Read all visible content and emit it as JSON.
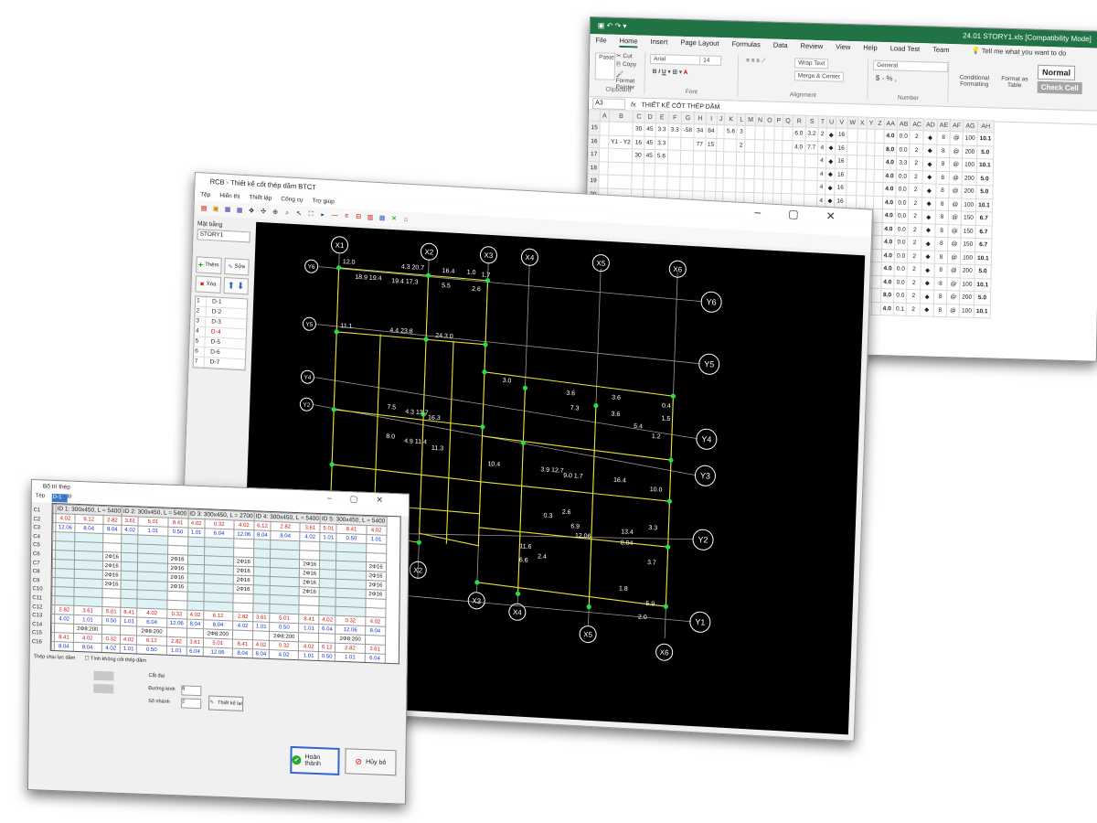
{
  "excel": {
    "doc_title": "24.01 STORY1.xls [Compatibility Mode]",
    "tabs": [
      "File",
      "Home",
      "Insert",
      "Page Layout",
      "Formulas",
      "Data",
      "Review",
      "View",
      "Help",
      "Load Test",
      "Team"
    ],
    "active_tab": "Home",
    "tell_me": "Tell me what you want to do",
    "clipboard": {
      "paste": "Paste",
      "cut": "Cut",
      "copy": "Copy",
      "painter": "Format Painter",
      "caption": "Clipboard"
    },
    "font": {
      "name": "Arial",
      "size": "14",
      "caption": "Font"
    },
    "alignment": {
      "wrap": "Wrap Text",
      "merge": "Merge & Center",
      "caption": "Alignment"
    },
    "number": {
      "format": "General",
      "caption": "Number",
      "symbols": "$ - % ,"
    },
    "styles": {
      "conditional": "Conditional Formatting",
      "format_table": "Format as Table",
      "normal": "Normal",
      "check": "Check Cell"
    },
    "formula_bar": {
      "name_box": "A3",
      "formula": "THIẾT KẾ CỐT THÉP DẦM",
      "fx": "fx"
    },
    "columns": [
      "",
      "A",
      "B",
      "C",
      "D",
      "E",
      "F",
      "G",
      "H",
      "I",
      "J",
      "K",
      "L",
      "M",
      "N",
      "O",
      "P",
      "Q",
      "R",
      "S",
      "T",
      "U",
      "V",
      "W",
      "X",
      "Y",
      "Z",
      "AA",
      "AB",
      "AC",
      "AD",
      "AE",
      "AF",
      "AG",
      "AH"
    ],
    "rows": [
      {
        "n": "15",
        "b": "",
        "c": "30",
        "d": "45",
        "e": "3.3",
        "f": "3.3",
        "g": "-58",
        "h": "34",
        "i": "84",
        "k": "5.6",
        "l": "3",
        "r": "6.0",
        "s": "3.2",
        "t": "2",
        "v": "16",
        "aa": "4.0",
        "ab": "0.0",
        "ac": "2",
        "ae": "8",
        "ag": "100",
        "ah": "10.1"
      },
      {
        "n": "16",
        "b": "Y1 - Y2",
        "c": "16",
        "d": "45",
        "e": "3.3",
        "f": "",
        "g": "",
        "h": "77",
        "i": "15",
        "k": "",
        "l": "2",
        "r": "4.0",
        "s": "7.7",
        "t": "4",
        "v": "16",
        "aa": "8.0",
        "ab": "0.0",
        "ac": "2",
        "ae": "8",
        "ag": "200",
        "ah": "5.0"
      },
      {
        "n": "17",
        "b": "",
        "c": "30",
        "d": "45",
        "e": "5.6",
        "f": "",
        "g": "",
        "h": "",
        "i": "",
        "k": "",
        "l": "",
        "r": "",
        "s": "",
        "t": "4",
        "v": "16",
        "aa": "4.0",
        "ab": "3.3",
        "ac": "2",
        "ae": "8",
        "ag": "100",
        "ah": "10.1"
      },
      {
        "n": "18",
        "b": "",
        "c": "",
        "d": "",
        "e": "",
        "f": "",
        "g": "",
        "h": "",
        "i": "",
        "k": "",
        "l": "",
        "r": "",
        "s": "",
        "t": "4",
        "v": "16",
        "aa": "4.0",
        "ab": "0.0",
        "ac": "2",
        "ae": "8",
        "ag": "200",
        "ah": "5.0"
      },
      {
        "n": "19",
        "b": "",
        "c": "",
        "d": "",
        "e": "",
        "f": "",
        "g": "",
        "h": "",
        "i": "",
        "k": "",
        "l": "",
        "r": "",
        "s": "",
        "t": "4",
        "v": "16",
        "aa": "4.0",
        "ab": "0.0",
        "ac": "2",
        "ae": "8",
        "ag": "200",
        "ah": "5.0"
      },
      {
        "n": "20",
        "b": "",
        "c": "",
        "d": "",
        "e": "",
        "f": "",
        "g": "",
        "h": "",
        "i": "",
        "k": "",
        "l": "",
        "r": "",
        "s": "",
        "t": "4",
        "v": "16",
        "aa": "4.0",
        "ab": "0.0",
        "ac": "2",
        "ae": "8",
        "ag": "100",
        "ah": "10.1"
      },
      {
        "n": "21",
        "b": "",
        "c": "",
        "d": "",
        "e": "",
        "f": "",
        "g": "",
        "h": "",
        "i": "",
        "k": "",
        "l": "",
        "r": "",
        "s": "",
        "t": "4",
        "v": "16",
        "aa": "4.0",
        "ab": "0.0",
        "ac": "2",
        "ae": "8",
        "ag": "150",
        "ah": "6.7"
      },
      {
        "n": "22",
        "b": "",
        "c": "",
        "d": "",
        "e": "",
        "f": "",
        "g": "",
        "h": "",
        "i": "",
        "k": "",
        "l": "",
        "r": "",
        "s": "",
        "t": "4",
        "v": "16",
        "aa": "4.0",
        "ab": "0.0",
        "ac": "2",
        "ae": "8",
        "ag": "150",
        "ah": "6.7"
      },
      {
        "n": "23",
        "b": "",
        "c": "",
        "d": "",
        "e": "",
        "f": "",
        "g": "",
        "h": "",
        "i": "",
        "k": "",
        "l": "",
        "r": "",
        "s": "",
        "t": "4",
        "v": "16",
        "aa": "4.0",
        "ab": "0.0",
        "ac": "2",
        "ae": "8",
        "ag": "150",
        "ah": "6.7"
      },
      {
        "n": "24",
        "b": "",
        "c": "",
        "d": "",
        "e": "",
        "f": "",
        "g": "",
        "h": "",
        "i": "",
        "k": "",
        "l": "",
        "r": "",
        "s": "",
        "t": "4",
        "v": "16",
        "aa": "4.0",
        "ab": "0.0",
        "ac": "2",
        "ae": "8",
        "ag": "100",
        "ah": "10.1"
      },
      {
        "n": "25",
        "b": "",
        "c": "",
        "d": "",
        "e": "",
        "f": "",
        "g": "",
        "h": "",
        "i": "",
        "k": "",
        "l": "",
        "r": "",
        "s": "",
        "t": "4",
        "v": "16",
        "aa": "4.0",
        "ab": "0.0",
        "ac": "2",
        "ae": "8",
        "ag": "200",
        "ah": "5.0"
      },
      {
        "n": "26",
        "b": "",
        "c": "",
        "d": "",
        "e": "",
        "f": "",
        "g": "",
        "h": "",
        "i": "",
        "k": "",
        "l": "",
        "r": "",
        "s": "",
        "t": "4",
        "v": "16",
        "aa": "4.0",
        "ab": "0.0",
        "ac": "2",
        "ae": "8",
        "ag": "100",
        "ah": "10.1"
      },
      {
        "n": "27",
        "b": "",
        "c": "",
        "d": "",
        "e": "",
        "f": "",
        "g": "",
        "h": "",
        "i": "",
        "k": "",
        "l": "",
        "r": "",
        "s": "",
        "t": "4",
        "v": "16",
        "aa": "8.0",
        "ab": "0.0",
        "ac": "2",
        "ae": "8",
        "ag": "200",
        "ah": "5.0"
      },
      {
        "n": "28",
        "b": "",
        "c": "",
        "d": "",
        "e": "",
        "f": "",
        "g": "",
        "h": "",
        "i": "",
        "k": "",
        "l": "",
        "r": "",
        "s": "",
        "t": "4",
        "v": "16",
        "aa": "4.0",
        "ab": "0.1",
        "ac": "2",
        "ae": "8",
        "ag": "100",
        "ah": "10.1"
      }
    ]
  },
  "beam_app": {
    "title": "RCB - Thiết kế cốt thép dầm BTCT",
    "menu": [
      "Tệp",
      "Hiển thị",
      "Thiết lập",
      "Công cụ",
      "Trợ giúp"
    ],
    "plan_label": "Mặt bằng",
    "story": "STORY1",
    "add": "Thêm",
    "edit": "Sửa",
    "delete": "Xóa",
    "beams": [
      {
        "n": "1",
        "name": "D-1"
      },
      {
        "n": "2",
        "name": "D-2"
      },
      {
        "n": "3",
        "name": "D-3"
      },
      {
        "n": "4",
        "name": "D-4"
      },
      {
        "n": "5",
        "name": "D-5"
      },
      {
        "n": "6",
        "name": "D-6"
      },
      {
        "n": "7",
        "name": "D-7"
      }
    ],
    "axes_x": [
      "X1",
      "X2",
      "X3",
      "X4",
      "X5",
      "X6"
    ],
    "axes_y": [
      "Y6",
      "Y5",
      "Y4",
      "Y3",
      "Y2",
      "Y1"
    ],
    "cad_labels": [
      "12.0",
      "4.3 20.7",
      "16.4",
      "1.0",
      "1.7",
      "18.9 19.4",
      "19.4 17.3",
      "5.5",
      "2.6",
      "11.1",
      "4.4 23.8",
      "24.3 0",
      "3.0",
      "3.6",
      "3.6",
      "0.4",
      "7.5",
      "4.3 13.7",
      "16.3",
      "7.3",
      "3.6",
      "1.5",
      "5.4",
      "1.2",
      "8.0",
      "4.9 11.4",
      "11.3",
      "10.4",
      "3.9 12.7",
      "9.0 1.7",
      "16.4",
      "10.0",
      "2.6",
      "6.9",
      "13.4",
      "3.3",
      "3.7",
      "0.3",
      "11.6",
      "6.6",
      "2.4",
      "1.8",
      "5.9",
      "2.0",
      "12.06",
      "8.04"
    ]
  },
  "dialog": {
    "title": "Bố trí thép",
    "menu": [
      "Tệp",
      "Giúp đỡ"
    ],
    "selector": "D-1",
    "side": [
      "C1",
      "C2",
      "C3",
      "C4",
      "C5",
      "C6",
      "C7",
      "C8",
      "C9",
      "C10",
      "C11",
      "C12",
      "C13",
      "C14",
      "C15",
      "C16"
    ],
    "spans": [
      "ID 1: 300x450, L = 5400",
      "ID 2: 300x450, L = 5400",
      "ID 3: 300x450, L = 2700",
      "ID 4: 300x450, L = 5400",
      "ID 5: 300x450, L = 5400"
    ],
    "steel_top": [
      "2Φ16",
      "2Φ16",
      "2Φ16",
      "2Φ16",
      "2Φ16",
      "2Φ16",
      "2Φ16",
      "2Φ16"
    ],
    "stirrups": [
      "2Φ8:100",
      "2Φ8:200",
      "2Φ8:100",
      "2Φ8:100",
      "2Φ8:200",
      "2Φ8:100"
    ],
    "values_red": [
      "4.02",
      "6.12",
      "2.82",
      "3.61",
      "5.01",
      "8.41",
      "4.02",
      "0.32"
    ],
    "values_blue": [
      "12.06",
      "8.04",
      "8.04",
      "4.02",
      "1.01",
      "0.50",
      "1.01",
      "6.04"
    ],
    "section_label": "Cắt đai",
    "check_option": "Tính không cốt thép dầm",
    "stirrup_dia": "Đường kính",
    "spacing": "Số nhánh",
    "dia_value": "8",
    "branch_value": "2",
    "design_btn": "Thiết kế lại",
    "done": "Hoàn thành",
    "cancel": "Hủy bỏ",
    "note": "Thép chịu lực dầm"
  }
}
